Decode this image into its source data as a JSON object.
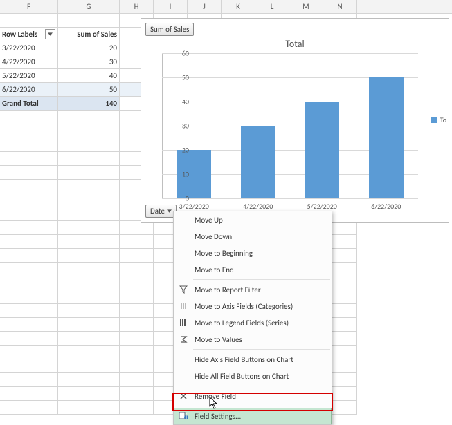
{
  "columns": [
    "F",
    "G",
    "H",
    "I",
    "J",
    "K",
    "L",
    "M",
    "N"
  ],
  "pivot": {
    "row_labels_header": "Row Labels",
    "sum_header": "Sum of Sales",
    "rows": [
      {
        "label": "3/22/2020",
        "value": "20"
      },
      {
        "label": "4/22/2020",
        "value": "30"
      },
      {
        "label": "5/22/2020",
        "value": "40"
      },
      {
        "label": "6/22/2020",
        "value": "50"
      }
    ],
    "grand_label": "Grand Total",
    "grand_value": "140"
  },
  "chart_data": {
    "type": "bar",
    "title": "Total",
    "categories": [
      "3/22/2020",
      "4/22/2020",
      "5/22/2020",
      "6/22/2020"
    ],
    "values": [
      20,
      30,
      40,
      50
    ],
    "ylim": [
      0,
      60
    ],
    "yticks": [
      0,
      10,
      20,
      30,
      40,
      50,
      60
    ],
    "legend": "To",
    "field_button_top": "Sum of Sales",
    "field_button_bottom": "Date"
  },
  "menu": {
    "move_up": "Move Up",
    "move_down": "Move Down",
    "move_begin": "Move to Beginning",
    "move_end": "Move to End",
    "report_filter": "Move to Report Filter",
    "axis_fields": "Move to Axis Fields (Categories)",
    "legend_fields": "Move to Legend Fields (Series)",
    "values": "Move to Values",
    "hide_axis": "Hide Axis Field Buttons on Chart",
    "hide_all": "Hide All Field Buttons on Chart",
    "remove": "Remove Field",
    "field_settings": "Field Settings..."
  }
}
